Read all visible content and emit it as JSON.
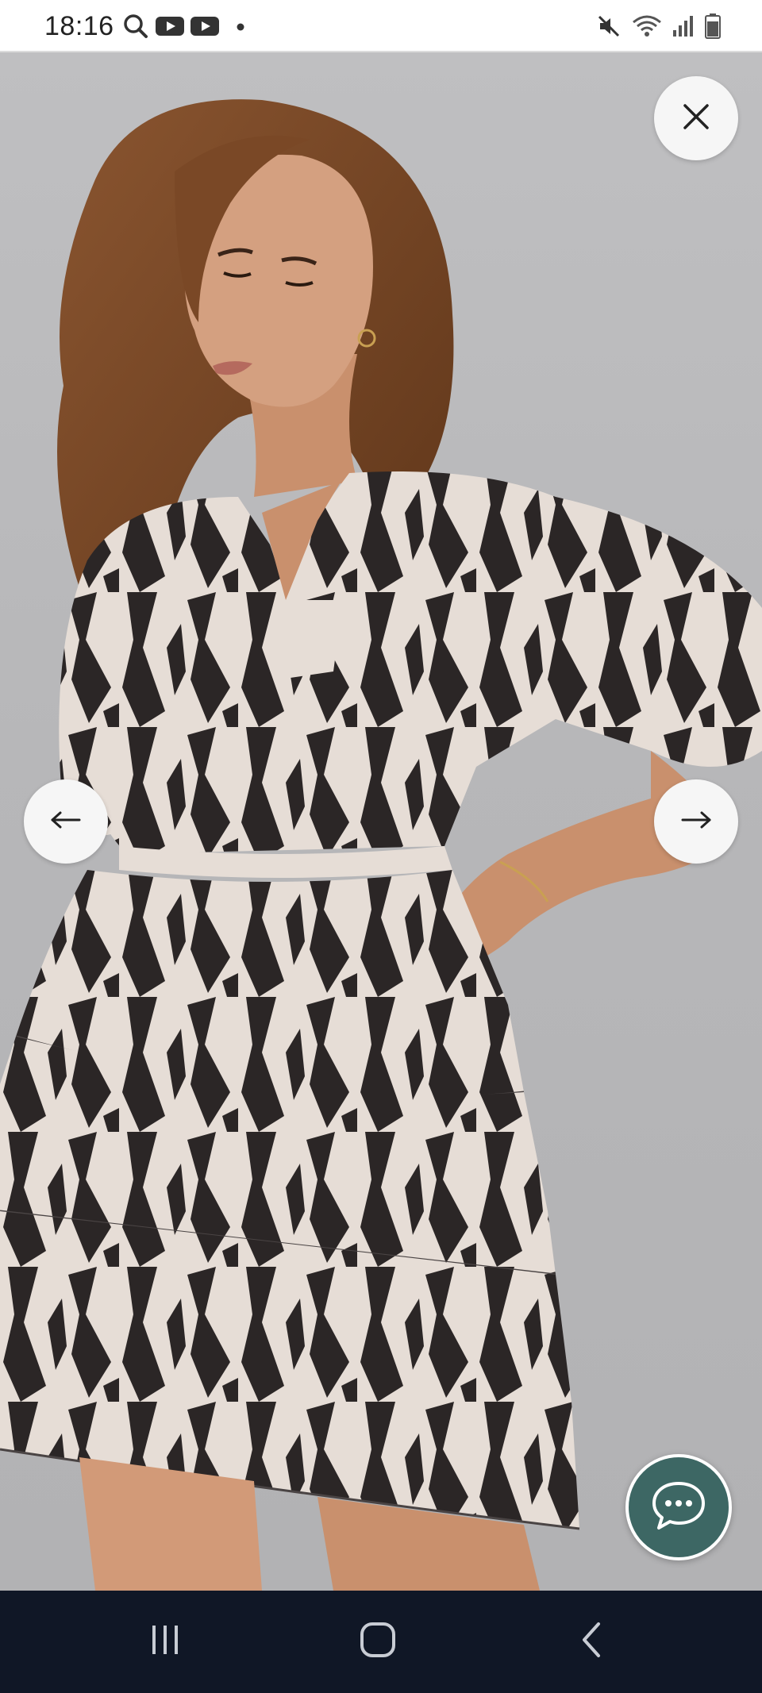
{
  "status_bar": {
    "time": "18:16",
    "left_icons": [
      "search-icon",
      "youtube-icon",
      "youtube-icon",
      "notification-dot-icon"
    ],
    "right_icons": [
      "mute-icon",
      "wifi-icon",
      "signal-icon",
      "battery-icon"
    ]
  },
  "viewer": {
    "image": "product-photo-patterned-tiered-dress",
    "close_icon": "close-icon",
    "prev_icon": "arrow-left-icon",
    "next_icon": "arrow-right-icon",
    "chat_icon": "chat-bubble-icon"
  },
  "nav_bar": {
    "recents_icon": "recents-icon",
    "home_icon": "home-icon",
    "back_icon": "back-icon"
  },
  "colors": {
    "chat_button": "#3d6764",
    "nav_bar": "#101726",
    "dress_dark": "#2b2626",
    "dress_light": "#e8dfd8",
    "backdrop": "#b9b9bb"
  }
}
